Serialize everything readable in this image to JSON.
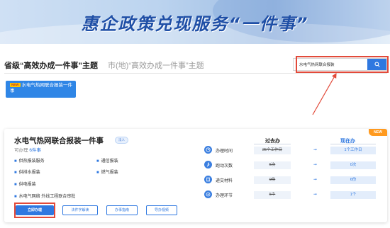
{
  "banner": {
    "title": "惠企政策兑现服务“一件事”"
  },
  "tabs": [
    {
      "label": "省级“高效办成一件事”主题",
      "active": true
    },
    {
      "label": "市(地)“高效办成一件事”主题",
      "active": false
    }
  ],
  "search": {
    "value": "水电气热网联合报装",
    "icon": "search-icon"
  },
  "chip": {
    "badge": "NEW",
    "label": "水电气热网联合报装一件事"
  },
  "card": {
    "new_badge": "NEW",
    "title": "水电气热网联合报装一件事",
    "badge": "法人",
    "sub_prefix": "可办理 ",
    "sub_count": "6件事",
    "items": [
      "供热报装服务",
      "通信报装",
      "供排水报装",
      "燃气报装",
      "供电报装",
      "水电气网络 外线工程联合审批"
    ],
    "buttons": [
      "立即办理",
      "法件字解读",
      "办事指南",
      "导办视频"
    ],
    "compare": {
      "old_header": "过去办",
      "new_header": "现在办",
      "rows": [
        {
          "label": "办理时间",
          "icon": "clock-icon",
          "old": "25个工作日",
          "new": "1个工作日"
        },
        {
          "label": "跑动次数",
          "icon": "run-icon",
          "old": "5次",
          "new": "0次"
        },
        {
          "label": "递交材料",
          "icon": "document-icon",
          "old": "9份",
          "new": "6份"
        },
        {
          "label": "办理环节",
          "icon": "steps-icon",
          "old": "5个",
          "new": "1个"
        }
      ]
    }
  },
  "colors": {
    "accent": "#2f78e0",
    "highlight": "#e24a3a",
    "new_badge": "#ff9a1f"
  }
}
